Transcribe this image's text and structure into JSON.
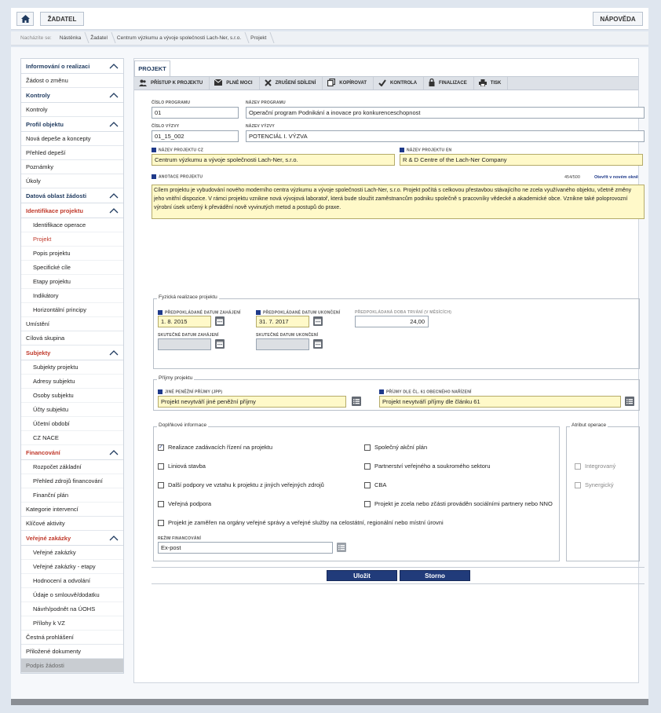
{
  "topbar": {
    "zadatel_label": "ŽADATEL",
    "help_label": "NÁPOVĚDA"
  },
  "breadcrumb": {
    "prefix": "Nacházíte se:",
    "items": [
      "Nástěnka",
      "Žadatel",
      "Centrum výzkumu a vývoje společnosti Lach-Ner, s.r.o.",
      "Projekt"
    ]
  },
  "sidebar": {
    "items": [
      {
        "label": "Informování o realizaci",
        "type": "section"
      },
      {
        "label": "Žádost o změnu",
        "type": "item"
      },
      {
        "label": "Kontroly",
        "type": "section"
      },
      {
        "label": "Kontroly",
        "type": "item"
      },
      {
        "label": "Profil objektu",
        "type": "section"
      },
      {
        "label": "Nová depeše a koncepty",
        "type": "item"
      },
      {
        "label": "Přehled depeší",
        "type": "item"
      },
      {
        "label": "Poznámky",
        "type": "item"
      },
      {
        "label": "Úkoly",
        "type": "item"
      },
      {
        "label": "Datová oblast žádosti",
        "type": "section"
      },
      {
        "label": "Identifikace projektu",
        "type": "section-red"
      },
      {
        "label": "Identifikace operace",
        "type": "sub"
      },
      {
        "label": "Projekt",
        "type": "sub-active"
      },
      {
        "label": "Popis projektu",
        "type": "sub"
      },
      {
        "label": "Specifické cíle",
        "type": "sub"
      },
      {
        "label": "Etapy projektu",
        "type": "sub"
      },
      {
        "label": "Indikátory",
        "type": "sub"
      },
      {
        "label": "Horizontální principy",
        "type": "sub"
      },
      {
        "label": "Umístění",
        "type": "item"
      },
      {
        "label": "Cílová skupina",
        "type": "item"
      },
      {
        "label": "Subjekty",
        "type": "section-red"
      },
      {
        "label": "Subjekty projektu",
        "type": "sub"
      },
      {
        "label": "Adresy subjektu",
        "type": "sub"
      },
      {
        "label": "Osoby subjektu",
        "type": "sub"
      },
      {
        "label": "Účty subjektu",
        "type": "sub"
      },
      {
        "label": "Účetní období",
        "type": "sub"
      },
      {
        "label": "CZ NACE",
        "type": "sub"
      },
      {
        "label": "Financování",
        "type": "section-red"
      },
      {
        "label": "Rozpočet základní",
        "type": "sub"
      },
      {
        "label": "Přehled zdrojů financování",
        "type": "sub"
      },
      {
        "label": "Finanční plán",
        "type": "sub"
      },
      {
        "label": "Kategorie intervencí",
        "type": "item"
      },
      {
        "label": "Klíčové aktivity",
        "type": "item"
      },
      {
        "label": "Veřejné zakázky",
        "type": "section-red"
      },
      {
        "label": "Veřejné zakázky",
        "type": "sub"
      },
      {
        "label": "Veřejné zakázky - etapy",
        "type": "sub"
      },
      {
        "label": "Hodnocení a odvolání",
        "type": "sub"
      },
      {
        "label": "Údaje o smlouvě/dodatku",
        "type": "sub"
      },
      {
        "label": "Návrh/podnět na ÚOHS",
        "type": "sub"
      },
      {
        "label": "Přílohy k VZ",
        "type": "sub"
      },
      {
        "label": "Čestná prohlášení",
        "type": "item"
      },
      {
        "label": "Přiložené dokumenty",
        "type": "item"
      },
      {
        "label": "Podpis žádosti",
        "type": "disabled"
      }
    ]
  },
  "tab": {
    "label": "PROJEKT"
  },
  "toolbar": {
    "buttons": [
      {
        "label": "PŘÍSTUP K PROJEKTU",
        "icon": "users-icon"
      },
      {
        "label": "PLNÉ MOCI",
        "icon": "envelope-icon"
      },
      {
        "label": "ZRUŠENÍ SDÍLENÍ",
        "icon": "close-icon"
      },
      {
        "label": "KOPÍROVAT",
        "icon": "copy-icon"
      },
      {
        "label": "KONTROLA",
        "icon": "check-icon"
      },
      {
        "label": "FINALIZACE",
        "icon": "lock-icon"
      },
      {
        "label": "TISK",
        "icon": "print-icon"
      }
    ]
  },
  "form": {
    "cislo_programu_label": "ČÍSLO PROGRAMU",
    "cislo_programu": "01",
    "nazev_programu_label": "NÁZEV PROGRAMU",
    "nazev_programu": "Operační program Podnikání a inovace pro konkurenceschopnost",
    "cislo_vyzvy_label": "ČÍSLO VÝZVY",
    "cislo_vyzvy": "01_15_002",
    "nazev_vyzvy_label": "NÁZEV VÝZVY",
    "nazev_vyzvy": "POTENCIÁL I. VÝZVA",
    "nazev_cz_label": "NÁZEV PROJEKTU CZ",
    "nazev_cz": "Centrum výzkumu a vývoje společnosti Lach-Ner, s.r.o.",
    "nazev_en_label": "NÁZEV PROJEKTU EN",
    "nazev_en": "R & D Centre of the Lach-Ner Company",
    "anotace_label": "ANOTACE PROJEKTU",
    "anotace_counter": "454/500",
    "anotace_link": "Otevřít v novém okně",
    "anotace": "Cílem projektu je vybudování nového moderního centra výzkumu a vývoje společnosti Lach-Ner, s.r.o. Projekt počítá s celkovou přestavbou stávajícího ne zcela využívaného objektu, včetně změny jeho vnitřní dispozice. V rámci projektu vznikne nová vývojová laboratoř, která bude sloužit zaměstnancům podniku společně s pracovníky vědecké a akademické obce. Vznikne také poloprovozní výrobní úsek určený k převádění nově vyvinutých metod a postupů do praxe."
  },
  "fyzicka": {
    "title": "Fyzická realizace projektu",
    "zahajeni_label": "PŘEDPOKLÁDANÉ DATUM ZAHÁJENÍ",
    "zahajeni": "1. 8. 2015",
    "ukonceni_label": "PŘEDPOKLÁDANÉ DATUM UKONČENÍ",
    "ukonceni": "31. 7. 2017",
    "doba_label": "PŘEDPOKLÁDANÁ DOBA TRVÁNÍ (V MĚSÍCÍCH)",
    "doba": "24,00",
    "sk_zahajeni_label": "SKUTEČNÉ DATUM ZAHÁJENÍ",
    "sk_ukonceni_label": "SKUTEČNÉ DATUM UKONČENÍ"
  },
  "prijmy": {
    "title": "Příjmy projektu",
    "jpp_label": "JINÉ PENĚŽNÍ PŘÍJMY (JPP)",
    "jpp": "Projekt nevytváří jiné peněžní příjmy",
    "cl61_label": "PŘÍJMY DLE ČL. 61 OBECNÉHO NAŘÍZENÍ",
    "cl61": "Projekt nevytváří příjmy dle článku 61"
  },
  "doplnkove": {
    "title": "Doplňkové informace",
    "checks": [
      {
        "label": "Realizace zadávacích řízení na projektu",
        "checked": true
      },
      {
        "label": "Společný akční plán",
        "checked": false
      },
      {
        "label": "Liniová stavba",
        "checked": false
      },
      {
        "label": "Partnerství veřejného a soukromého sektoru",
        "checked": false
      },
      {
        "label": "Další podpory ve vztahu k projektu z jiných veřejných zdrojů",
        "checked": false
      },
      {
        "label": "CBA",
        "checked": false
      },
      {
        "label": "Veřejná podpora",
        "checked": false
      },
      {
        "label": "Projekt je zcela nebo zčásti prováděn sociálními partnery nebo NNO",
        "checked": false
      },
      {
        "label": "Projekt je zaměřen na orgány veřejné správy a veřejné služby na celostátní, regionální nebo místní úrovni",
        "checked": false
      }
    ],
    "rezim_label": "REŽIM FINANCOVÁNÍ",
    "rezim": "Ex-post"
  },
  "atribut": {
    "title": "Atribut operace",
    "integrovany": "Integrovaný",
    "synergicky": "Synergický"
  },
  "buttons": {
    "save": "Uložit",
    "cancel": "Storno"
  }
}
